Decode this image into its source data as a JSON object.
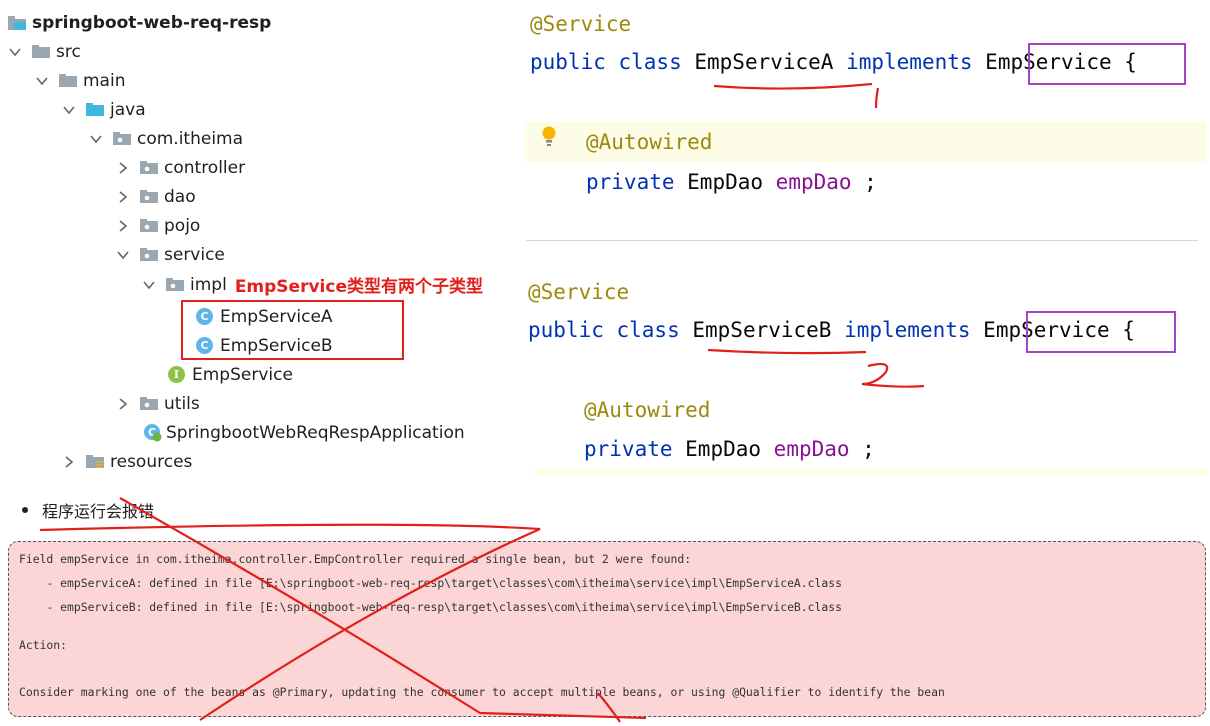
{
  "tree": {
    "project": "springboot-web-req-resp",
    "src": "src",
    "main": "main",
    "java": "java",
    "package": "com.itheima",
    "controller": "controller",
    "dao": "dao",
    "pojo": "pojo",
    "service": "service",
    "impl": "impl",
    "annotation": "EmpService类型有两个子类型",
    "classA": "EmpServiceA",
    "classB": "EmpServiceB",
    "interface": "EmpService",
    "utils": "utils",
    "app": "SpringbootWebReqRespApplication",
    "resources": "resources",
    "class_badge": "C",
    "interface_badge": "I"
  },
  "codeA": {
    "annotation": "@Service",
    "kw1": "public class ",
    "name": "EmpServiceA",
    "kw2": " implements ",
    "iface": "EmpService",
    "brace": " {",
    "autowired": "@Autowired",
    "kw3": "private ",
    "type": "EmpDao ",
    "field": "empDao",
    "semi": " ;"
  },
  "codeB": {
    "annotation": "@Service",
    "kw1": "public class ",
    "name": "EmpServiceB",
    "kw2": " implements ",
    "iface": "EmpService",
    "brace": " {",
    "autowired": "@Autowired",
    "kw3": "private ",
    "type": "EmpDao ",
    "field": "empDao",
    "semi": " ;"
  },
  "bullet": "程序运行会报错",
  "error": {
    "line1": "Field empService in com.itheima.controller.EmpController required a single bean, but 2 were found:",
    "line2": "    - empServiceA: defined in file [E:\\springboot-web-req-resp\\target\\classes\\com\\itheima\\service\\impl\\EmpServiceA.class",
    "line3": "    - empServiceB: defined in file [E:\\springboot-web-req-resp\\target\\classes\\com\\itheima\\service\\impl\\EmpServiceB.class",
    "line4": "Action:",
    "line5": "Consider marking one of the beans as @Primary, updating the consumer to accept multiple beans, or using @Qualifier to identify the bean"
  },
  "colors": {
    "annotation_red": "#e0211b",
    "box_purple": "#a046c4",
    "error_bg": "#fcd6d6",
    "keyword": "#0033b3",
    "field": "#871094",
    "annotation_code": "#9e880d"
  }
}
